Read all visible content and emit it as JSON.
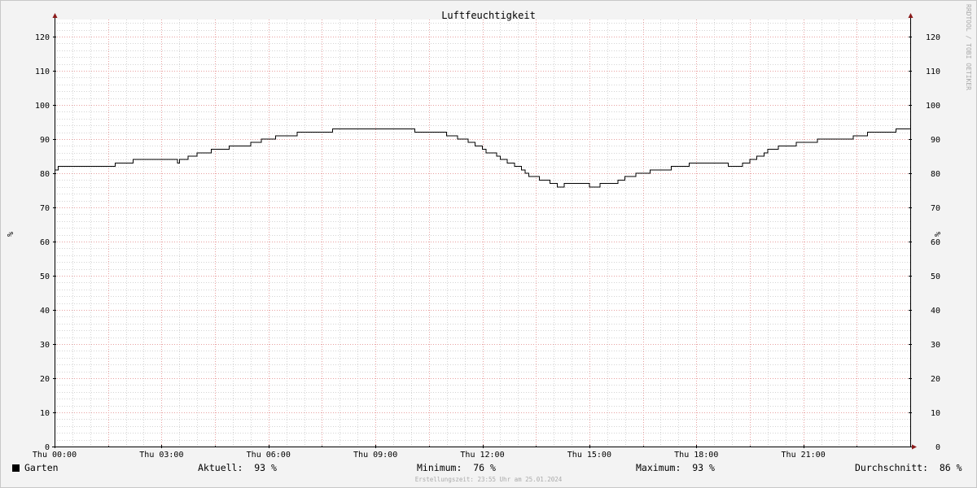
{
  "chart_data": {
    "type": "line",
    "title": "Luftfeuchtigkeit",
    "ylabel_left": "%",
    "ylabel_right": "%",
    "ylim": [
      0,
      125
    ],
    "xlim": [
      "Thu 00:00",
      "Thu 24:00"
    ],
    "y_ticks": [
      "0",
      "10",
      "20",
      "30",
      "40",
      "50",
      "60",
      "70",
      "80",
      "90",
      "100",
      "110",
      "120"
    ],
    "x_tick_labels": [
      "Thu 00:00",
      "Thu 03:00",
      "Thu 06:00",
      "Thu 09:00",
      "Thu 12:00",
      "Thu 15:00",
      "Thu 18:00",
      "Thu 21:00"
    ],
    "grid": true,
    "series": [
      {
        "name": "Garten",
        "color": "#000000",
        "x_hours": [
          0,
          0.1,
          1.7,
          2.2,
          3.3,
          3.45,
          3.5,
          3.75,
          4.0,
          4.4,
          4.9,
          5.0,
          5.5,
          5.8,
          6.2,
          6.8,
          7.8,
          8.0,
          10.1,
          10.2,
          11.0,
          11.3,
          11.6,
          11.8,
          12.0,
          12.1,
          12.2,
          12.4,
          12.5,
          12.7,
          12.9,
          13.1,
          13.2,
          13.3,
          13.4,
          13.6,
          13.9,
          14.1,
          14.2,
          14.3,
          15.0,
          15.3,
          15.8,
          16.0,
          16.3,
          16.7,
          17.3,
          17.8,
          18.9,
          19.0,
          19.3,
          19.5,
          19.6,
          19.7,
          19.9,
          20.0,
          20.2,
          20.3,
          20.5,
          20.8,
          21.4,
          21.7,
          22.4,
          22.8,
          23.4,
          23.6,
          24.0
        ],
        "values": [
          81,
          82,
          83,
          84,
          84,
          83,
          84,
          85,
          86,
          87,
          88,
          88,
          89,
          90,
          91,
          92,
          93,
          93,
          92,
          92,
          91,
          90,
          89,
          88,
          87,
          86,
          86,
          85,
          84,
          83,
          82,
          81,
          80,
          79,
          79,
          78,
          77,
          76,
          76,
          77,
          76,
          77,
          78,
          79,
          80,
          81,
          82,
          83,
          82,
          82,
          83,
          84,
          84,
          85,
          86,
          87,
          87,
          88,
          88,
          89,
          90,
          90,
          91,
          92,
          92,
          93,
          93
        ]
      }
    ]
  },
  "legend": {
    "series_label": "Garten",
    "current_label": "Aktuell:",
    "current_value": "93 %",
    "min_label": "Minimum:",
    "min_value": "76 %",
    "max_label": "Maximum:",
    "max_value": "93 %",
    "avg_label": "Durchschnitt:",
    "avg_value": "86 %"
  },
  "watermark": "RRDTOOL / TOBI OETIKER",
  "footer_note": "Erstellungszeit: 23:55 Uhr am 25.01.2024",
  "colors": {
    "background": "#f3f3f3",
    "plot_background": "#ffffff",
    "major_grid": "#e8a0a0",
    "minor_grid": "#d4d4d4",
    "axis": "#000000",
    "arrow": "#8b1a1a"
  }
}
